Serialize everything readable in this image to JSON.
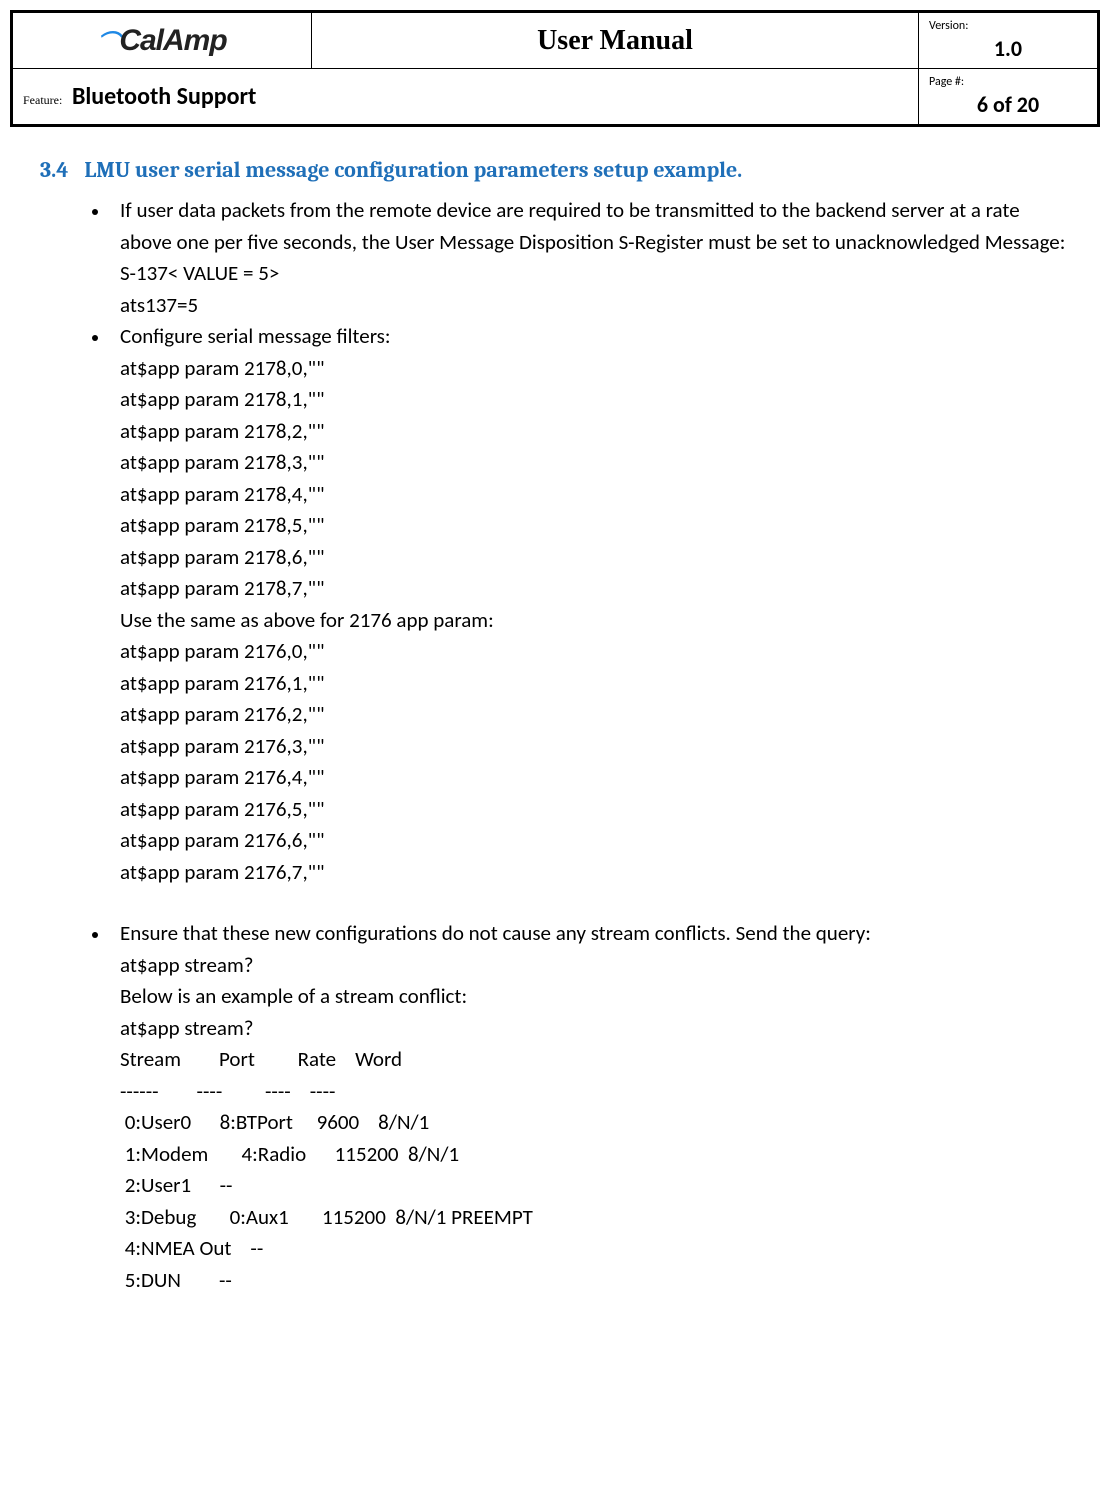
{
  "header": {
    "logo_text": "CalAmp",
    "title": "User Manual",
    "version_label": "Version:",
    "version_value": "1.0",
    "feature_label": "Feature:",
    "feature_value": "Bluetooth Support",
    "page_label": "Page #:",
    "page_value": "6 of 20"
  },
  "section": {
    "number": "3.4",
    "title": "LMU user serial message  configuration parameters setup example."
  },
  "bullets": [
    {
      "intro": "If user data packets from the remote device are required to be transmitted to the backend server at a rate above one per five seconds, the User Message Disposition S-Register must be set to unacknowledged Message:",
      "lines": [
        "S-137< VALUE = 5>",
        "ats137=5"
      ]
    },
    {
      "intro": "Configure serial message filters:",
      "lines": [
        "at$app param 2178,0,\"\"",
        "at$app param 2178,1,\"\"",
        "at$app param 2178,2,\"\"",
        "at$app param 2178,3,\"\"",
        "at$app param 2178,4,\"\"",
        "at$app param 2178,5,\"\"",
        "at$app param 2178,6,\"\"",
        "at$app param 2178,7,\"\"",
        "Use the same as above for 2176 app param:",
        "at$app param 2176,0,\"\"",
        "at$app param 2176,1,\"\"",
        "at$app param 2176,2,\"\"",
        "at$app param 2176,3,\"\"",
        "at$app param 2176,4,\"\"",
        "at$app param 2176,5,\"\"",
        "at$app param 2176,6,\"\"",
        "at$app param 2176,7,\"\""
      ]
    },
    {
      "intro": "Ensure that these new configurations do not cause any stream conflicts. Send the query:",
      "lines": [
        "at$app stream?",
        "Below is an example of a stream conflict:",
        " at$app stream?"
      ],
      "mono": "Stream        Port         Rate    Word\n------        ----         ----    ----\n 0:User0      8:BTPort     9600    8/N/1\n 1:Modem       4:Radio      115200  8/N/1\n 2:User1      --\n 3:Debug       0:Aux1       115200  8/N/1 PREEMPT\n 4:NMEA Out    --\n 5:DUN        --"
    }
  ]
}
